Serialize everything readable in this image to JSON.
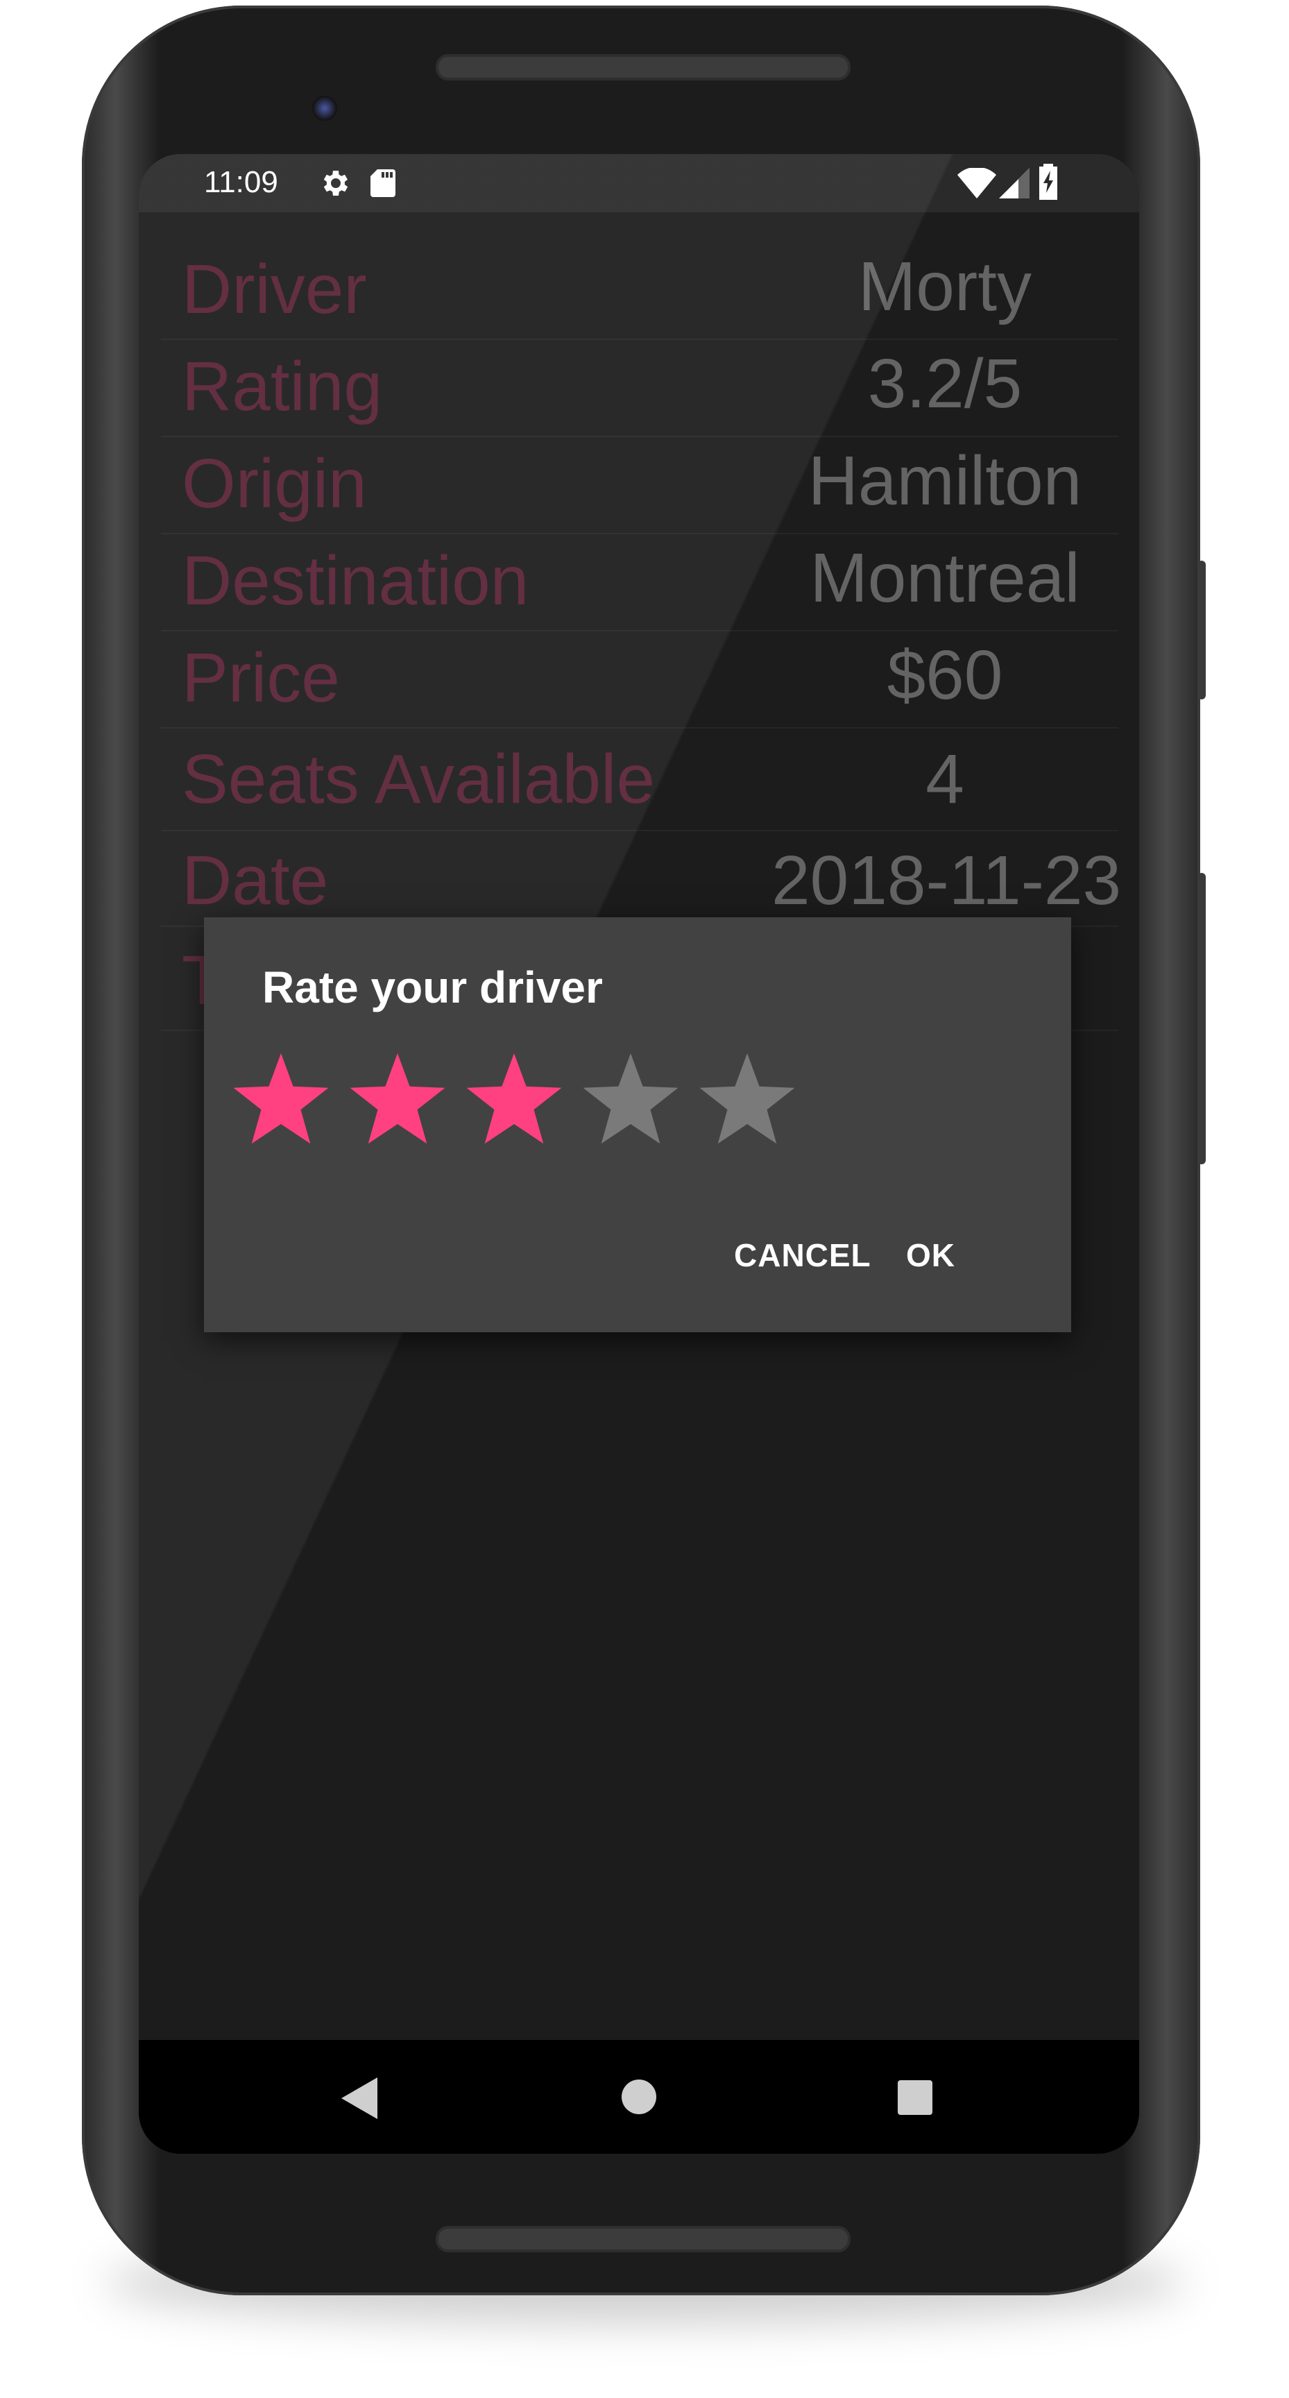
{
  "status_bar": {
    "time": "11:09",
    "icons": [
      "gear-icon",
      "sd-card-icon",
      "wifi-icon",
      "signal-icon",
      "battery-charging-icon"
    ]
  },
  "trip_details": [
    {
      "label": "Driver",
      "value": "Morty"
    },
    {
      "label": "Rating",
      "value": "3.2/5"
    },
    {
      "label": "Origin",
      "value": "Hamilton"
    },
    {
      "label": "Destination",
      "value": "Montreal"
    },
    {
      "label": "Price",
      "value": "$60"
    },
    {
      "label": "Seats Available",
      "value": "4"
    },
    {
      "label": "Date",
      "value": "2018-11-23"
    },
    {
      "label": "T",
      "value": ""
    }
  ],
  "rating_dialog": {
    "title": "Rate your driver",
    "rating": 3,
    "max_rating": 5,
    "cancel_label": "CANCEL",
    "ok_label": "OK"
  },
  "nav_bar": {
    "icons": [
      "back-icon",
      "home-icon",
      "recents-icon"
    ]
  },
  "colors": {
    "star_filled": "#ff4081",
    "star_empty": "#7a7a7a",
    "label": "#5a2236",
    "value": "#646464",
    "dialog_bg": "#424242"
  }
}
